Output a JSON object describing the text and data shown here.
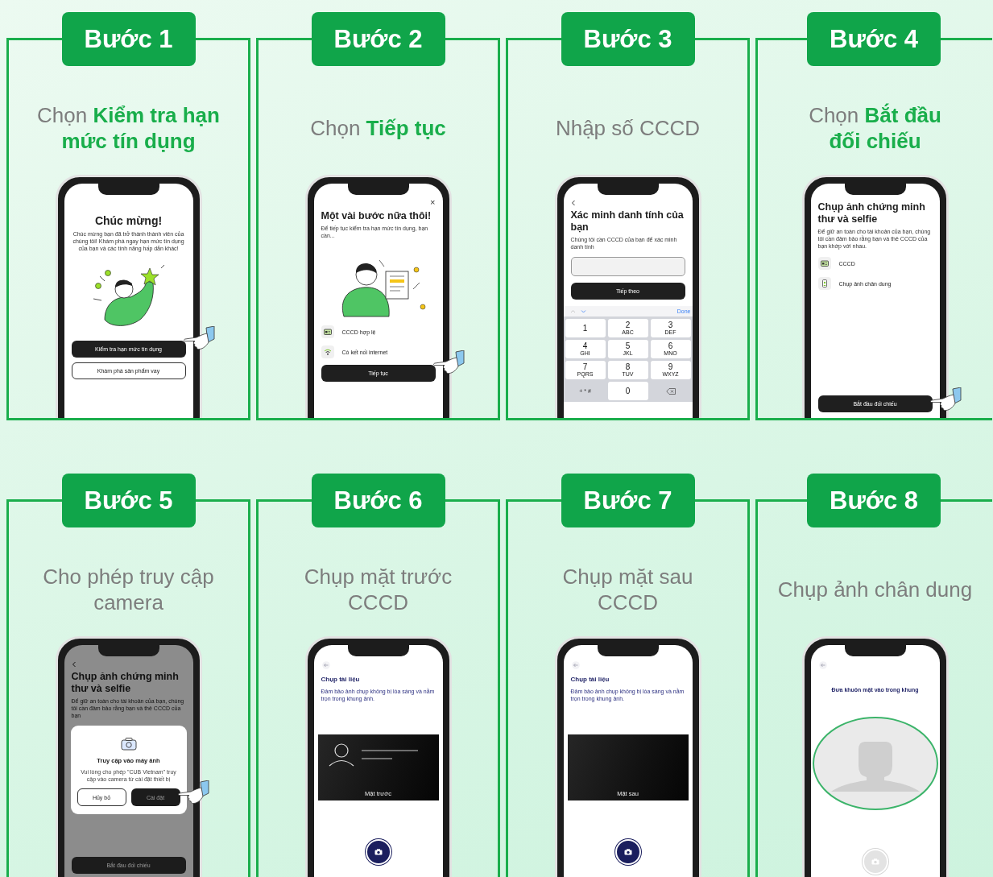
{
  "steps": [
    {
      "badge": "Bước 1",
      "caption": "Chọn **Kiểm tra hạn**\n**mức tín dụng**",
      "screen": {
        "dimmed": false,
        "items": [
          {
            "kind": "title",
            "text": "Chúc mừng!"
          },
          {
            "kind": "message",
            "text": "Chúc mừng bạn đã trở thành thành viên của chúng tôi! Khám phá ngay hạn mức tín dụng của bạn và các tính năng hấp dẫn khác!"
          },
          {
            "kind": "celebrate-art"
          },
          {
            "kind": "primary-button",
            "text": "Kiểm tra hạn mức tín dụng",
            "pointer": true
          },
          {
            "kind": "outline-button",
            "text": "Khám phá sản phẩm vay"
          }
        ]
      }
    },
    {
      "badge": "Bước 2",
      "caption": "Chọn **Tiếp tục**",
      "screen": {
        "dimmed": false,
        "items": [
          {
            "kind": "close",
            "text": "×"
          },
          {
            "kind": "heading",
            "text": "Một vài bước nữa thôi!"
          },
          {
            "kind": "body",
            "text": "Để tiếp tục kiểm tra hạn mức tín dụng, bạn cần..."
          },
          {
            "kind": "thinking-art"
          },
          {
            "kind": "id-row",
            "text": "CCCD hợp lệ"
          },
          {
            "kind": "wifi-row",
            "text": "Có kết nối internet"
          },
          {
            "kind": "primary-button",
            "text": "Tiếp tục",
            "pointer": true
          }
        ]
      }
    },
    {
      "badge": "Bước 3",
      "caption": "Nhập số CCCD",
      "screen": {
        "dimmed": false,
        "items": [
          {
            "kind": "back-chevron"
          },
          {
            "kind": "heading",
            "text": "Xác minh danh tính của bạn"
          },
          {
            "kind": "body",
            "text": "Chúng tôi cần CCCD của bạn để xác minh danh tính"
          },
          {
            "kind": "input"
          },
          {
            "kind": "primary-button",
            "text": "Tiếp theo",
            "pointer": false
          },
          {
            "kind": "keypad",
            "done": "Done",
            "keys": [
              {
                "kind": "digit",
                "label": "1"
              },
              {
                "kind": "digit",
                "label": "2",
                "letters": "ABC"
              },
              {
                "kind": "digit",
                "label": "3",
                "letters": "DEF"
              },
              {
                "kind": "digit",
                "label": "4",
                "letters": "GHI"
              },
              {
                "kind": "digit",
                "label": "5",
                "letters": "JKL"
              },
              {
                "kind": "digit",
                "label": "6",
                "letters": "MNO"
              },
              {
                "kind": "digit",
                "label": "7",
                "letters": "PQRS"
              },
              {
                "kind": "digit",
                "label": "8",
                "letters": "TUV"
              },
              {
                "kind": "digit",
                "label": "9",
                "letters": "WXYZ"
              },
              {
                "kind": "symbols",
                "label": "+ * #"
              },
              {
                "kind": "digit",
                "label": "0"
              },
              {
                "kind": "delete"
              }
            ]
          }
        ]
      }
    },
    {
      "badge": "Bước 4",
      "caption": "Chọn **Bắt đầu**\n**đối chiếu**",
      "screen": {
        "dimmed": false,
        "items": [
          {
            "kind": "heading",
            "text": "Chụp ảnh chứng minh thư và selfie"
          },
          {
            "kind": "body",
            "text": "Để giữ an toàn cho tài khoản của bạn, chúng tôi cần đảm bảo rằng bạn và thẻ CCCD của bạn khớp với nhau."
          },
          {
            "kind": "id-row",
            "text": "CCCD"
          },
          {
            "kind": "portrait-row",
            "text": "Chụp ảnh chân dung"
          },
          {
            "kind": "footer-button",
            "text": "Bắt đầu đối chiếu",
            "pointer": true
          }
        ]
      }
    },
    {
      "badge": "Bước 5",
      "caption": "Cho phép truy cập\ncamera",
      "screen": {
        "dimmed": true,
        "items": [
          {
            "kind": "back-chevron"
          },
          {
            "kind": "heading",
            "text": "Chụp ảnh chứng minh thư và selfie"
          },
          {
            "kind": "body",
            "text": "Để giữ an toàn cho tài khoản của bạn, chúng tôi cần đảm bảo rằng bạn và thẻ CCCD của bạn"
          },
          {
            "kind": "footer-button",
            "text": "Bắt đầu đối chiếu",
            "pointer": false
          }
        ],
        "dialog": {
          "title": "Truy cập vào máy ảnh",
          "text": "Vui lòng cho phép \"CUB Vietnam\" truy cập vào camera từ cài đặt thiết bị",
          "buttons": [
            {
              "kind": "outline",
              "text": "Hủy bỏ",
              "pointer": false
            },
            {
              "kind": "primary",
              "text": "Cài đặt",
              "pointer": true
            }
          ]
        }
      }
    },
    {
      "badge": "Bước 6",
      "caption": "Chụp mặt trước\nCCCD",
      "screen": {
        "dimmed": false,
        "items": [
          {
            "kind": "back-arrow"
          },
          {
            "kind": "doc-heading",
            "text": "Chụp tài liệu"
          },
          {
            "kind": "doc-body",
            "text": "Đảm bảo ảnh chụp không bị lóa sáng và nằm trọn trong khung ảnh."
          },
          {
            "kind": "front-frame",
            "text": "Mặt trước"
          },
          {
            "kind": "shutter",
            "disabled": false
          }
        ]
      }
    },
    {
      "badge": "Bước 7",
      "caption": "Chụp mặt sau\nCCCD",
      "screen": {
        "dimmed": false,
        "items": [
          {
            "kind": "back-arrow"
          },
          {
            "kind": "doc-heading",
            "text": "Chụp tài liệu"
          },
          {
            "kind": "doc-body",
            "text": "Đảm bảo ảnh chụp không bị lóa sáng và nằm trọn trong khung ảnh."
          },
          {
            "kind": "back-frame",
            "text": "Mặt sau"
          },
          {
            "kind": "shutter",
            "disabled": false
          }
        ]
      }
    },
    {
      "badge": "Bước 8",
      "caption": "Chụp ảnh chân dung",
      "screen": {
        "dimmed": false,
        "items": [
          {
            "kind": "back-arrow"
          },
          {
            "kind": "prompt",
            "text": "Đưa khuôn mặt vào trong khung"
          },
          {
            "kind": "face-frame"
          },
          {
            "kind": "shutter",
            "disabled": true
          }
        ]
      }
    }
  ]
}
